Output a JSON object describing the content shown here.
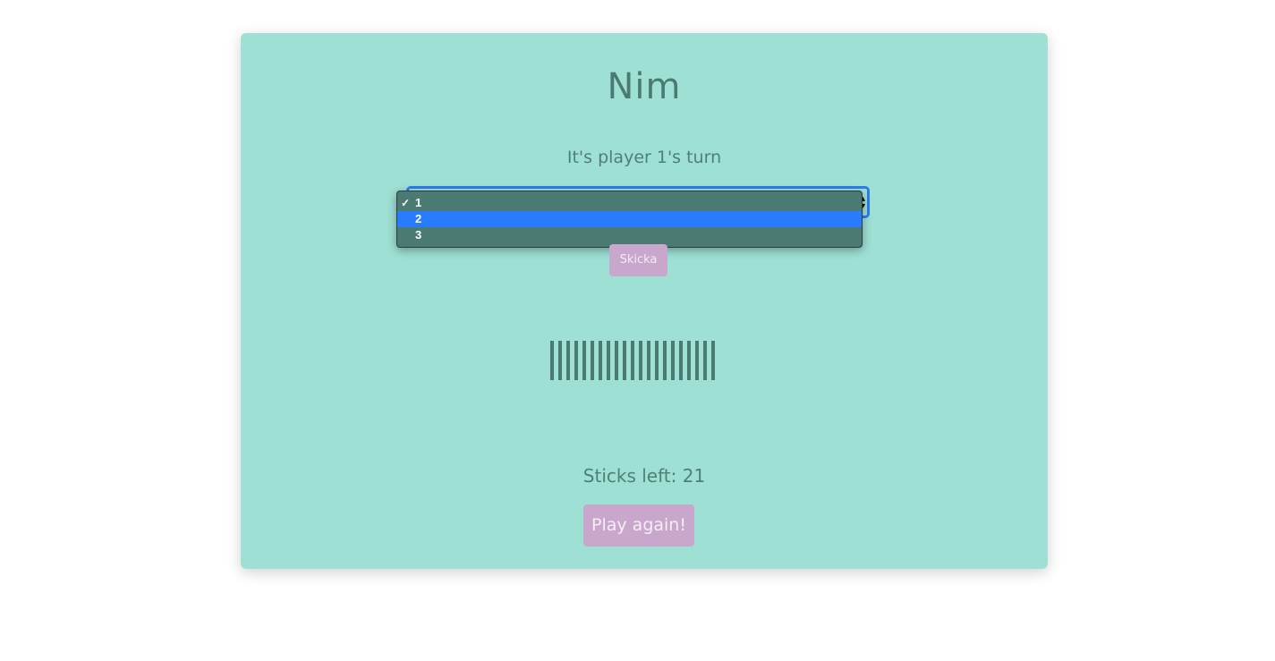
{
  "title": "Nim",
  "turn_text": "It's player 1's turn",
  "select": {
    "selected": "1",
    "options": [
      {
        "label": "1",
        "checked": true,
        "highlighted": false
      },
      {
        "label": "2",
        "checked": false,
        "highlighted": true
      },
      {
        "label": "3",
        "checked": false,
        "highlighted": false
      }
    ]
  },
  "submit_label": "Skicka",
  "sticks_count": 21,
  "sticks_left_text": "Sticks left: 21",
  "play_again_label": "Play again!",
  "colors": {
    "card_bg": "#9ee0d4",
    "text": "#4a7a72",
    "button_bg": "#c9a7cc",
    "focus_ring": "#2f7bf0",
    "highlight": "#2a7cff"
  }
}
